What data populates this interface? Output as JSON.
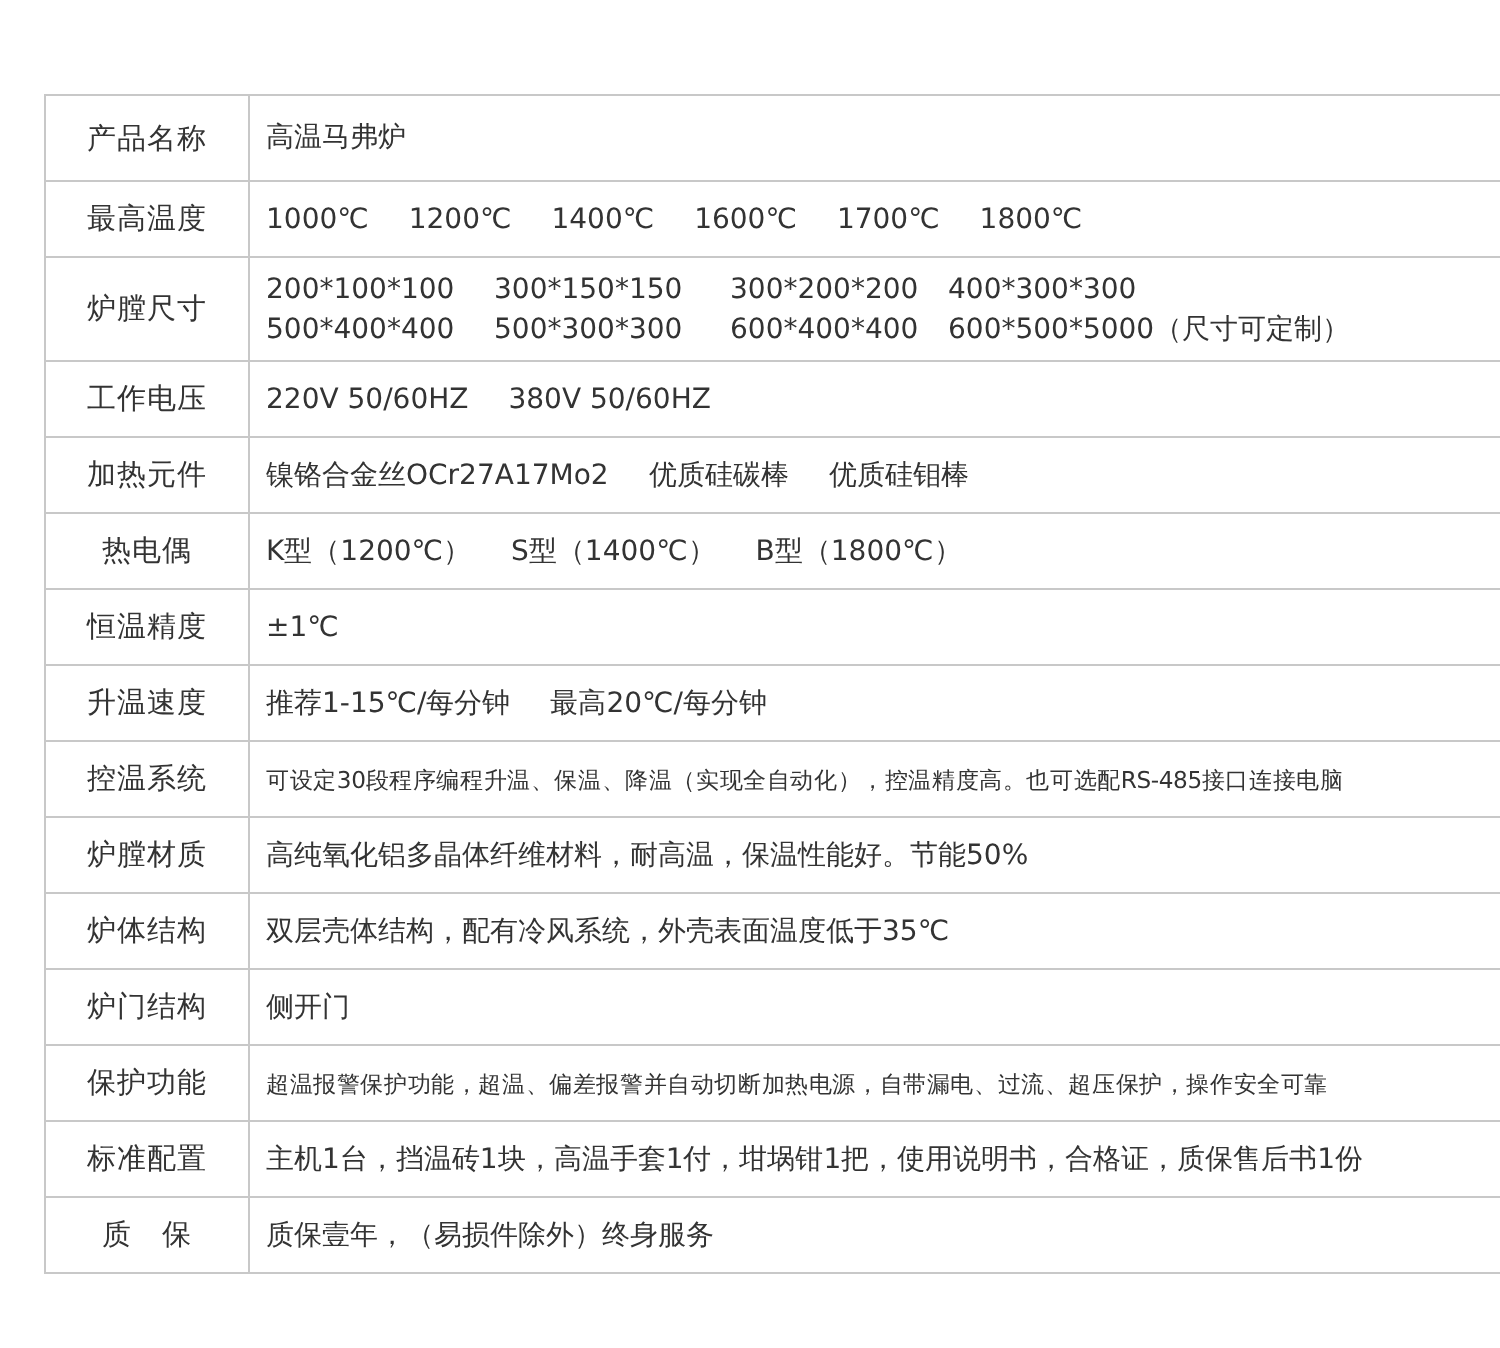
{
  "spec_table": {
    "rows": [
      {
        "label": "产品名称",
        "kind": "normal",
        "lines": [
          [
            "高温马弗炉"
          ]
        ]
      },
      {
        "label": "最高温度",
        "kind": "normal",
        "lines": [
          [
            "1000℃",
            "1200℃",
            "1400℃",
            "1600℃",
            "1700℃",
            "1800℃"
          ]
        ]
      },
      {
        "label": "炉膛尺寸",
        "kind": "grid",
        "lines": [
          [
            "200*100*100",
            "300*150*150",
            "300*200*200",
            "400*300*300"
          ],
          [
            "500*400*400",
            "500*300*300",
            "600*400*400",
            "600*500*5000（尺寸可定制）"
          ]
        ]
      },
      {
        "label": "工作电压",
        "kind": "normal",
        "lines": [
          [
            "220V 50/60HZ",
            "380V 50/60HZ"
          ]
        ]
      },
      {
        "label": "加热元件",
        "kind": "normal",
        "lines": [
          [
            "镍铬合金丝OCr27A17Mo2",
            "优质硅碳棒",
            "优质硅钼棒"
          ]
        ]
      },
      {
        "label": "热电偶",
        "kind": "normal",
        "lines": [
          [
            "K型（1200℃）",
            "S型（1400℃）",
            "B型（1800℃）"
          ]
        ]
      },
      {
        "label": "恒温精度",
        "kind": "normal",
        "lines": [
          [
            "±1℃"
          ]
        ]
      },
      {
        "label": "升温速度",
        "kind": "normal",
        "lines": [
          [
            "推荐1-15℃/每分钟",
            "最高20℃/每分钟"
          ]
        ]
      },
      {
        "label": "控温系统",
        "kind": "small",
        "lines": [
          [
            "可设定30段程序编程升温、保温、降温（实现全自动化），控温精度高。也可选配RS-485接口连接电脑"
          ]
        ]
      },
      {
        "label": "炉膛材质",
        "kind": "normal",
        "lines": [
          [
            "高纯氧化铝多晶体纤维材料，耐高温，保温性能好。节能50%"
          ]
        ]
      },
      {
        "label": "炉体结构",
        "kind": "normal",
        "lines": [
          [
            "双层壳体结构，配有冷风系统，外壳表面温度低于35℃"
          ]
        ]
      },
      {
        "label": "炉门结构",
        "kind": "normal",
        "lines": [
          [
            "侧开门"
          ]
        ]
      },
      {
        "label": "保护功能",
        "kind": "small",
        "lines": [
          [
            "超温报警保护功能，超温、偏差报警并自动切断加热电源，自带漏电、过流、超压保护，操作安全可靠"
          ]
        ]
      },
      {
        "label": "标准配置",
        "kind": "normal",
        "lines": [
          [
            "主机1台，挡温砖1块，高温手套1付，坩埚钳1把，使用说明书，合格证，质保售后书1份"
          ]
        ]
      },
      {
        "label": "质　保",
        "kind": "normal",
        "lines": [
          [
            "质保壹年，（易损件除外）终身服务"
          ]
        ]
      }
    ]
  }
}
